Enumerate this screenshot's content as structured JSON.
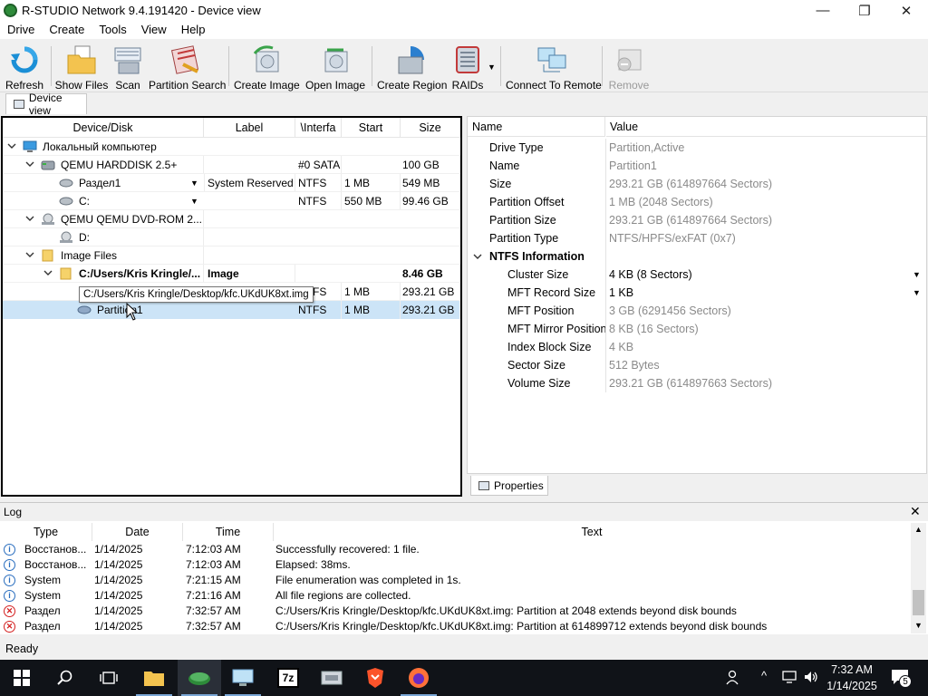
{
  "window": {
    "title": "R-STUDIO Network 9.4.191420 - Device view",
    "minimize": "—",
    "maximize": "❐",
    "close": "✕"
  },
  "menu": [
    "Drive",
    "Create",
    "Tools",
    "View",
    "Help"
  ],
  "toolbar": [
    {
      "label": "Refresh",
      "icon": "refresh-icon"
    },
    {
      "label": "Show Files",
      "icon": "folder-files-icon"
    },
    {
      "label": "Scan",
      "icon": "scan-icon"
    },
    {
      "label": "Partition Search",
      "icon": "partition-search-icon"
    },
    {
      "label": "Create Image",
      "icon": "create-image-icon"
    },
    {
      "label": "Open Image",
      "icon": "open-image-icon"
    },
    {
      "label": "Create Region",
      "icon": "create-region-icon"
    },
    {
      "label": "RAIDs",
      "icon": "raid-icon"
    },
    {
      "label": "Connect To Remote",
      "icon": "connect-remote-icon"
    },
    {
      "label": "Remove",
      "icon": "remove-icon",
      "disabled": true
    }
  ],
  "tabs": {
    "device_view": "Device view",
    "properties": "Properties"
  },
  "device_table": {
    "headers": [
      "Device/Disk",
      "Label",
      "\\Interfa",
      "Start",
      "Size"
    ],
    "rows": [
      {
        "name": "Локальный компьютер",
        "label": "",
        "iface": "",
        "start": "",
        "size": ""
      },
      {
        "name": "QEMU HARDDISK 2.5+",
        "label": "",
        "iface": "#0 SATA",
        "start": "",
        "size": "100 GB"
      },
      {
        "name": "Раздел1",
        "label": "System Reserved",
        "iface": "NTFS",
        "start": "1 MB",
        "size": "549 MB"
      },
      {
        "name": "C:",
        "label": "",
        "iface": "NTFS",
        "start": "550 MB",
        "size": "99.46 GB"
      },
      {
        "name": "QEMU QEMU DVD-ROM 2....",
        "label": "",
        "iface": "",
        "start": "",
        "size": ""
      },
      {
        "name": "D:",
        "label": "",
        "iface": "",
        "start": "",
        "size": ""
      },
      {
        "name": "Image Files",
        "label": "",
        "iface": "",
        "start": "",
        "size": ""
      },
      {
        "name": "C:/Users/Kris Kringle/...",
        "label": "Image",
        "iface": "",
        "start": "",
        "size": "8.46 GB"
      },
      {
        "name": "",
        "label": "",
        "iface": "NTFS",
        "start": "1 MB",
        "size": "293.21 GB"
      },
      {
        "name": "Partition1",
        "label": "",
        "iface": "NTFS",
        "start": "1 MB",
        "size": "293.21 GB"
      }
    ],
    "tooltip": "C:/Users/Kris Kringle/Desktop/kfc.UKdUK8xt.img"
  },
  "properties": {
    "headers": {
      "name": "Name",
      "value": "Value"
    },
    "rows": [
      {
        "name": "Drive Type",
        "value": "Partition,Active"
      },
      {
        "name": "Name",
        "value": "Partition1"
      },
      {
        "name": "Size",
        "value": "293.21 GB (614897664 Sectors)"
      },
      {
        "name": "Partition Offset",
        "value": "1 MB (2048 Sectors)"
      },
      {
        "name": "Partition Size",
        "value": "293.21 GB (614897664 Sectors)"
      },
      {
        "name": "Partition Type",
        "value": "NTFS/HPFS/exFAT (0x7)"
      },
      {
        "name": "NTFS Information",
        "value": ""
      },
      {
        "name": "Cluster Size",
        "value": "4 KB (8 Sectors)"
      },
      {
        "name": "MFT Record Size",
        "value": "1 KB"
      },
      {
        "name": "MFT Position",
        "value": "3 GB (6291456 Sectors)"
      },
      {
        "name": "MFT Mirror Position",
        "value": "8 KB (16 Sectors)"
      },
      {
        "name": "Index Block Size",
        "value": "4 KB"
      },
      {
        "name": "Sector Size",
        "value": "512 Bytes"
      },
      {
        "name": "Volume Size",
        "value": "293.21 GB (614897663 Sectors)"
      }
    ]
  },
  "log": {
    "title": "Log",
    "headers": [
      "Type",
      "Date",
      "Time",
      "Text"
    ],
    "rows": [
      {
        "kind": "info",
        "type": "Восстанов...",
        "date": "1/14/2025",
        "time": "7:12:03 AM",
        "text": "Successfully recovered: 1 file."
      },
      {
        "kind": "info",
        "type": "Восстанов...",
        "date": "1/14/2025",
        "time": "7:12:03 AM",
        "text": "Elapsed: 38ms."
      },
      {
        "kind": "info",
        "type": "System",
        "date": "1/14/2025",
        "time": "7:21:15 AM",
        "text": "File enumeration was completed in 1s."
      },
      {
        "kind": "info",
        "type": "System",
        "date": "1/14/2025",
        "time": "7:21:16 AM",
        "text": "All file regions are collected."
      },
      {
        "kind": "error",
        "type": "Раздел",
        "date": "1/14/2025",
        "time": "7:32:57 AM",
        "text": "C:/Users/Kris Kringle/Desktop/kfc.UKdUK8xt.img: Partition at 2048 extends beyond disk bounds"
      },
      {
        "kind": "error",
        "type": "Раздел",
        "date": "1/14/2025",
        "time": "7:32:57 AM",
        "text": "C:/Users/Kris Kringle/Desktop/kfc.UKdUK8xt.img: Partition at 614899712 extends beyond disk bounds"
      }
    ]
  },
  "status": "Ready",
  "taskbar": {
    "time": "7:32 AM",
    "date": "1/14/2025",
    "notification_count": "5"
  }
}
